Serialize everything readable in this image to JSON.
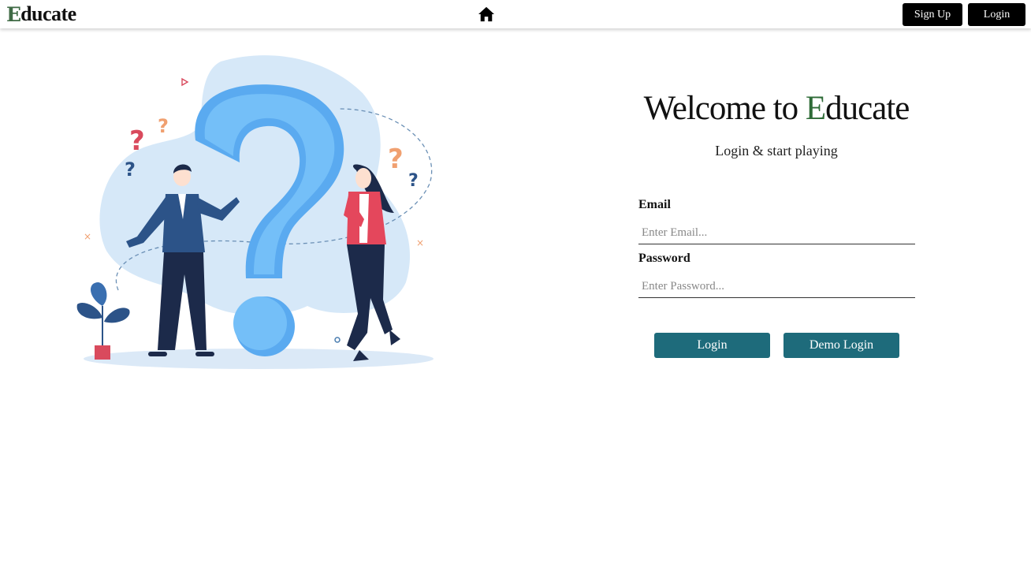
{
  "navbar": {
    "brand_initial": "E",
    "brand_rest": "ducate",
    "home_icon": "home-icon",
    "signup_label": "Sign Up",
    "login_label": "Login"
  },
  "hero": {
    "illustration": "question-mark-people-illustration"
  },
  "form": {
    "welcome_prefix": "Welcome to ",
    "welcome_accent": "E",
    "welcome_suffix": "ducate",
    "subtitle": "Login & start playing",
    "email_label": "Email",
    "email_placeholder": "Enter Email...",
    "email_value": "",
    "password_label": "Password",
    "password_placeholder": "Enter Password...",
    "password_value": "",
    "login_button": "Login",
    "demo_login_button": "Demo Login"
  },
  "colors": {
    "brand_green": "#2e6b37",
    "button_teal": "#1e6b7b",
    "nav_button": "#000000"
  }
}
